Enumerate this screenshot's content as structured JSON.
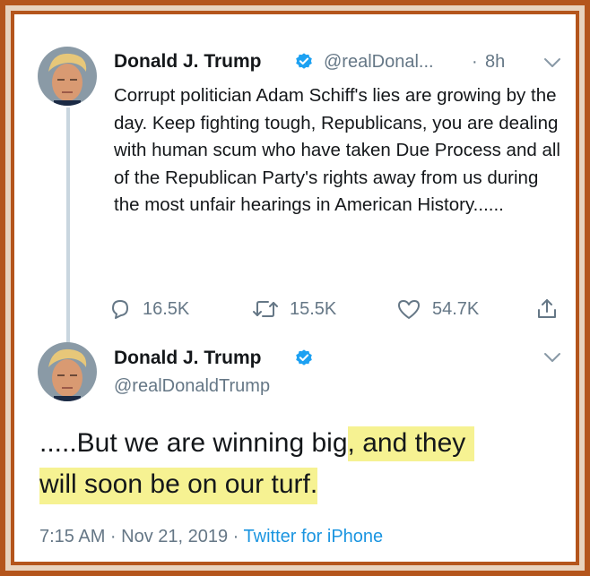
{
  "tweet1": {
    "author_name": "Donald J. Trump",
    "handle": "@realDonal...",
    "separator": "·",
    "time": "8h",
    "text": "Corrupt politician Adam Schiff's lies are growing by the day. Keep fighting tough, Republicans, you are dealing with human scum who have taken Due Process and all of the Republican Party's rights away from us during the most unfair hearings in American History......",
    "replies": "16.5K",
    "retweets": "15.5K",
    "likes": "54.7K"
  },
  "tweet2": {
    "author_name": "Donald J. Trump",
    "handle": "@realDonaldTrump",
    "text_plain": ".....But we are winning big",
    "text_highlight_1": ", and they",
    "text_highlight_2": "will soon be on our turf.",
    "timestamp": "7:15 AM · Nov 21, 2019 ·",
    "source": "Twitter for iPhone"
  },
  "colors": {
    "frame": "#b4551c",
    "frame_inner": "#e8d2bd",
    "highlight": "#f6f292",
    "link_blue": "#1b95e0",
    "verified_blue": "#1da1f2",
    "secondary_text": "#657786"
  }
}
